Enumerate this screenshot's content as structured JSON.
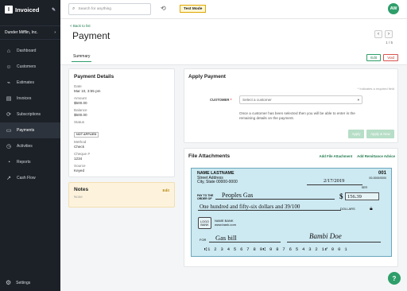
{
  "app": {
    "name": "Invoiced",
    "logo_letter": "I"
  },
  "sidebar": {
    "company": "Dunder Mifflin, Inc.",
    "items": [
      {
        "label": "Dashboard",
        "icon": "dashboard-icon"
      },
      {
        "label": "Customers",
        "icon": "customers-icon"
      },
      {
        "label": "Estimates",
        "icon": "estimates-icon"
      },
      {
        "label": "Invoices",
        "icon": "invoices-icon"
      },
      {
        "label": "Subscriptions",
        "icon": "subscriptions-icon"
      },
      {
        "label": "Payments",
        "icon": "payments-icon"
      },
      {
        "label": "Activities",
        "icon": "activities-icon"
      },
      {
        "label": "Reports",
        "icon": "reports-icon"
      },
      {
        "label": "Cash Flow",
        "icon": "cash-flow-icon"
      }
    ],
    "active": "Payments",
    "settings": "Settings"
  },
  "topbar": {
    "search_placeholder": "Search for anything",
    "test_mode": "Test Mode",
    "avatar": "AW"
  },
  "header": {
    "back": "< Back to list",
    "title": "Payment",
    "page_count": "1 / 5",
    "tab": "Summary",
    "edit": "Edit",
    "void": "Void"
  },
  "payment_details": {
    "heading": "Payment Details",
    "date_label": "Date",
    "date": "Mar 10, 3:55 pm",
    "amount_label": "Amount",
    "amount": "$500.00",
    "balance_label": "Balance",
    "balance": "$500.00",
    "status_label": "Status",
    "status": "NOT APPLIED",
    "method_label": "Method",
    "method": "Check",
    "cheque_label": "Cheque #",
    "cheque": "1234",
    "source_label": "Source",
    "source": "Keyed"
  },
  "notes": {
    "heading": "Notes",
    "edit": "Edit",
    "value": "None"
  },
  "apply_payment": {
    "heading": "Apply Payment",
    "required_note": "* Indicates a required field",
    "customer_label": "CUSTOMER",
    "customer_placeholder": "Select a customer",
    "helper": "Once a customer has been selected then you will be able to enter in the remaining details on the payment.",
    "apply": "Apply",
    "apply_new": "Apply & New"
  },
  "attachments": {
    "heading": "File Attachments",
    "add_file": "Add File Attachment",
    "add_remit": "Add Remittance Advice",
    "check": {
      "holder_name": "NAME LASTNAME",
      "holder_street": "Street Address",
      "holder_city": "City, State 00000-0000",
      "number": "001",
      "routing": "00-0000/0000",
      "date": "2/17/2019",
      "ser": "SER",
      "pay_to": "PAY TO THE ORDER OF",
      "payee": "Peoples Gas",
      "dollar_sign": "$",
      "amount": "156.39",
      "amount_words": "One hundred and fifty-six dollars and 39/100",
      "dollars": "DOLLARS",
      "bank_logo": "LOGO BANK",
      "bank_name": "NAME BANK",
      "bank_url": "www.bank.com",
      "for": "FOR",
      "memo": "Gas bill",
      "signature": "Bambi Doe",
      "micr": "⑆1 2 3 4 5 6 7 8 9⑆ 9 8 7 6 5 4 3 2 1⑈ 0 0 1"
    }
  },
  "help": "?",
  "colors": {
    "brand": "#2e9e6a",
    "sidebar": "#1c2128",
    "void": "#d9534f",
    "notes_bg": "#fdf3dd"
  }
}
